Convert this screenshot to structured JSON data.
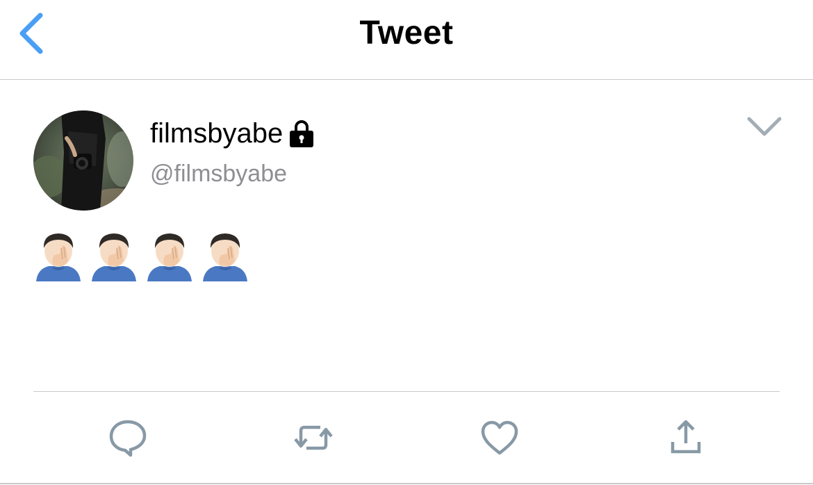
{
  "nav": {
    "title": "Tweet",
    "back_icon": "chevron-left-icon"
  },
  "tweet": {
    "display_name": "filmsbyabe",
    "handle": "@filmsbyabe",
    "protected_icon": "lock-icon",
    "menu_icon": "chevron-down-icon",
    "text": "🤦🏻‍♂️🤦🏻‍♂️🤦🏻‍♂️🤦🏻‍♂️"
  },
  "actions": {
    "reply_icon": "reply-icon",
    "retweet_icon": "retweet-icon",
    "like_icon": "heart-icon",
    "share_icon": "share-icon"
  },
  "colors": {
    "accent": "#4a9ff5",
    "icon_gray": "#8899a6",
    "handle_gray": "#8e8e93",
    "separator": "#c8c8cc"
  }
}
